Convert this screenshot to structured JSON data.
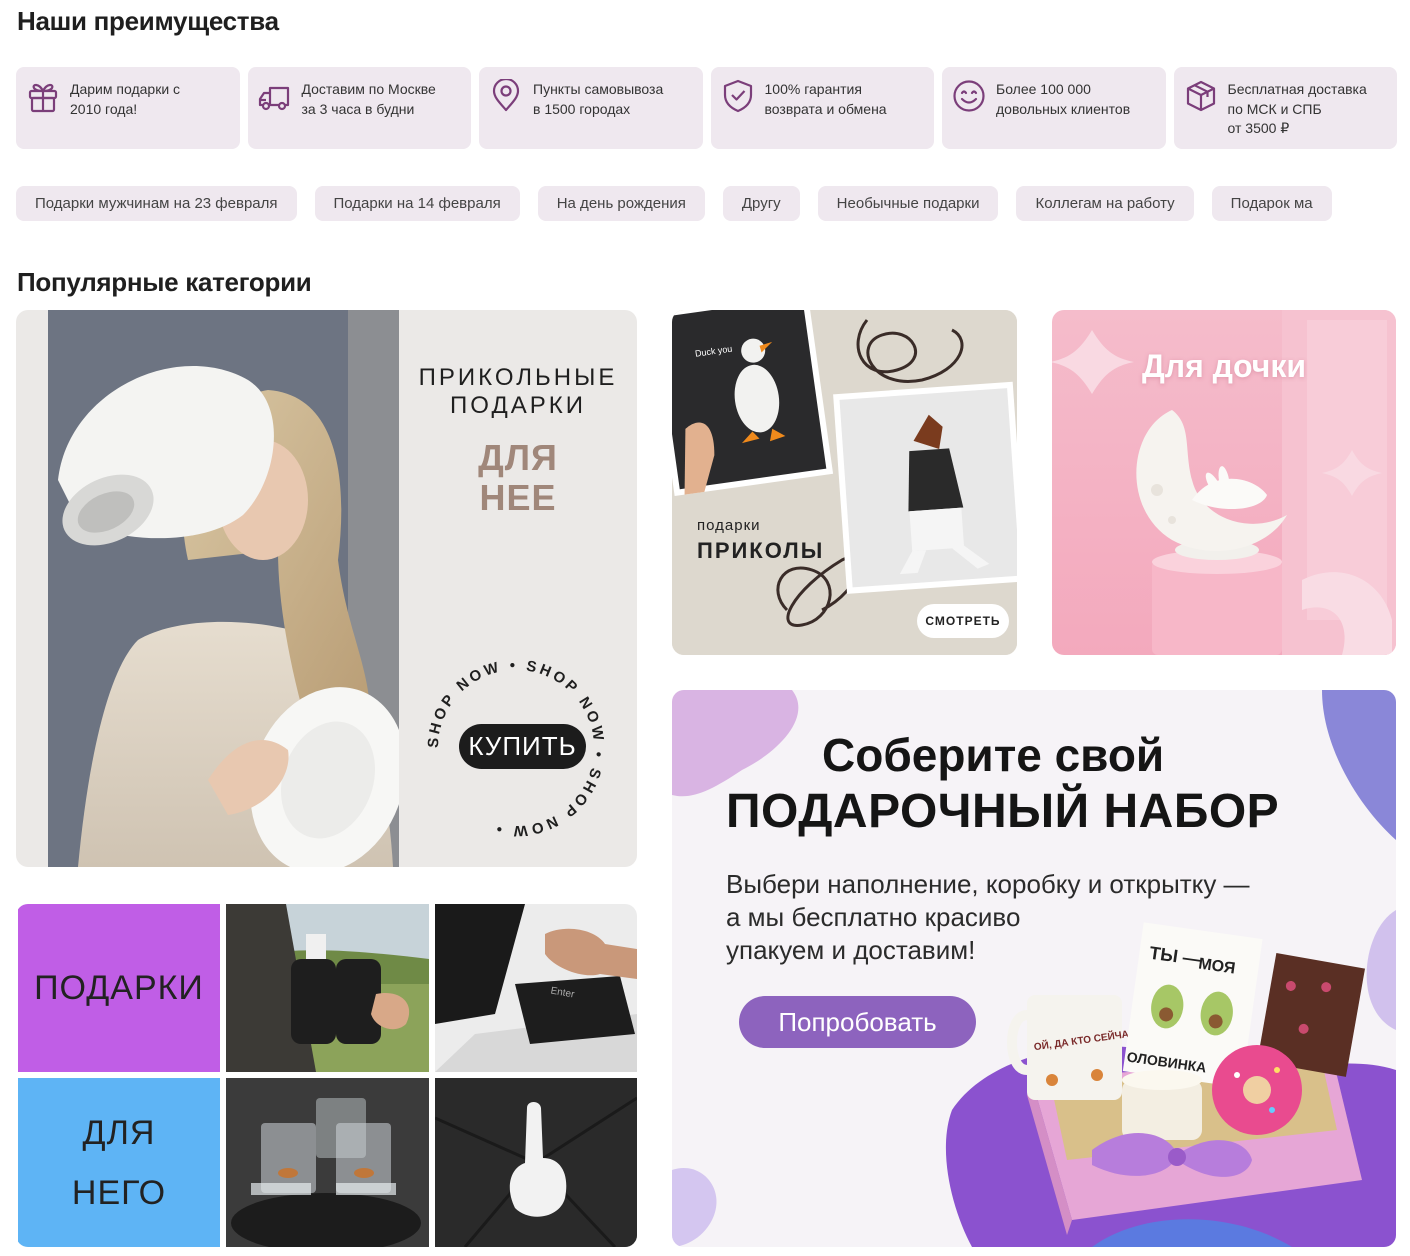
{
  "advantages_section": {
    "title": "Наши преимущества",
    "items": [
      {
        "icon": "gift-icon",
        "text": "Дарим подарки с\n2010 года!"
      },
      {
        "icon": "truck-icon",
        "text": "Доставим по Москве\nза 3 часа в будни"
      },
      {
        "icon": "location-pin-icon",
        "text": "Пункты самовывоза\nв 1500 городах"
      },
      {
        "icon": "shield-check-icon",
        "text": "100% гарантия\nвозврата и обмена"
      },
      {
        "icon": "smiley-icon",
        "text": "Более 100 000\nдовольных клиентов"
      },
      {
        "icon": "box-icon",
        "text": "Бесплатная доставка\nпо МСК и СПБ\nот 3500 ₽"
      }
    ]
  },
  "chips": [
    "Подарки мужчинам на 23 февраля",
    "Подарки на 14 февраля",
    "На день рождения",
    "Другу",
    "Необычные подарки",
    "Коллегам на работу",
    "Подарок ма"
  ],
  "categories_section": {
    "title": "Популярные категории",
    "card_her": {
      "line1": "ПРИКОЛЬНЫЕ",
      "line2": "ПОДАРКИ",
      "accent1": "ДЛЯ",
      "accent2": "НЕЕ",
      "circle_text": "SHOP NOW • SHOP NOW • SHOP NOW • ",
      "button": "КУПИТЬ"
    },
    "card_fun": {
      "small": "подарки",
      "big": "ПРИКОЛЫ",
      "photo_caption": "Duck you",
      "button": "СМОТРЕТЬ"
    },
    "card_daughter": {
      "title": "Для дочки"
    },
    "card_set": {
      "title1": "Соберите свой",
      "title2": "ПОДАРОЧНЫЙ НАБОР",
      "desc": "Выбери наполнение, коробку и открытку —\nа мы бесплатно красиво\nупакуем и доставим!",
      "button": "Попробовать",
      "card_text1": "ТЫ —",
      "card_text2": "МОЯ",
      "card_text3": "ОЛОВИНКА",
      "mug_text": "ОЙ, ДА КТО СЕЙЧАС НЕ ЖИРНЫЙ"
    },
    "card_him": {
      "label1": "ПОДАРКИ",
      "label2a": "ДЛЯ",
      "label2b": "НЕГО",
      "key_text": "Enter"
    }
  },
  "colors": {
    "chip_bg": "#efe8ef",
    "icon_accent": "#7b3e7a",
    "purple_button": "#8d63be",
    "him_purple": "#c05ee6",
    "him_blue": "#5eb4f5"
  }
}
